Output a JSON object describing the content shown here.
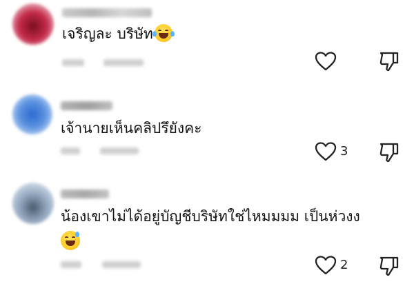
{
  "comments": [
    {
      "text": "เจริญละ บริษัท",
      "emoji": "😂",
      "likes": ""
    },
    {
      "text": "เจ้านายเห็นคลิปรึยังคะ",
      "emoji": "",
      "likes": "3"
    },
    {
      "text": "น้องเขาไม่ได้อยู่บัญชีบริษัทใช่ไหมมมม เป็นห่วงง",
      "emoji": "😅",
      "likes": "2"
    }
  ],
  "colors": {
    "icon_stroke": "#222222",
    "avatar1": "#b3203c",
    "avatar2": "#3f7fd0",
    "avatar3": "#8fa9c8"
  }
}
